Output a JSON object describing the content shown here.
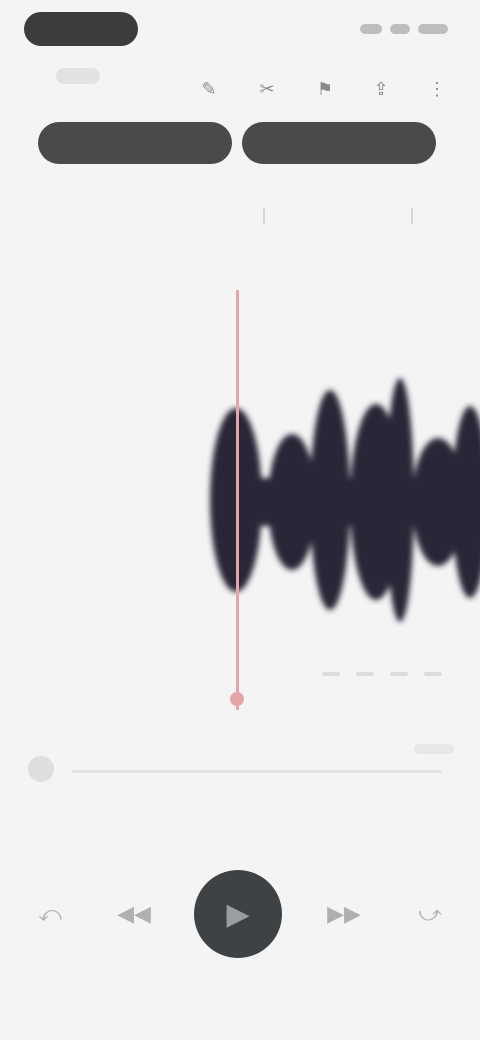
{
  "status_bar": {
    "time": "",
    "icons": [
      "signal-icon",
      "wifi-icon",
      "battery-icon"
    ]
  },
  "toolbar": {
    "title": "",
    "icons": [
      "edit-icon",
      "trim-icon",
      "bookmark-icon",
      "share-icon",
      "more-icon"
    ]
  },
  "segmented": {
    "left_label": "",
    "right_label": ""
  },
  "ruler": {
    "labels": [
      "",
      ""
    ]
  },
  "scrubber": {
    "position": 0
  },
  "transport": {
    "buttons": [
      "skip-back-icon",
      "rewind-icon",
      "play-icon",
      "fast-forward-icon",
      "skip-forward-icon"
    ]
  },
  "colors": {
    "background": "#f4f4f4",
    "accent_dark": "#3c3c3c",
    "playhead": "#e7a4a8",
    "waveform": "#2a2838"
  }
}
